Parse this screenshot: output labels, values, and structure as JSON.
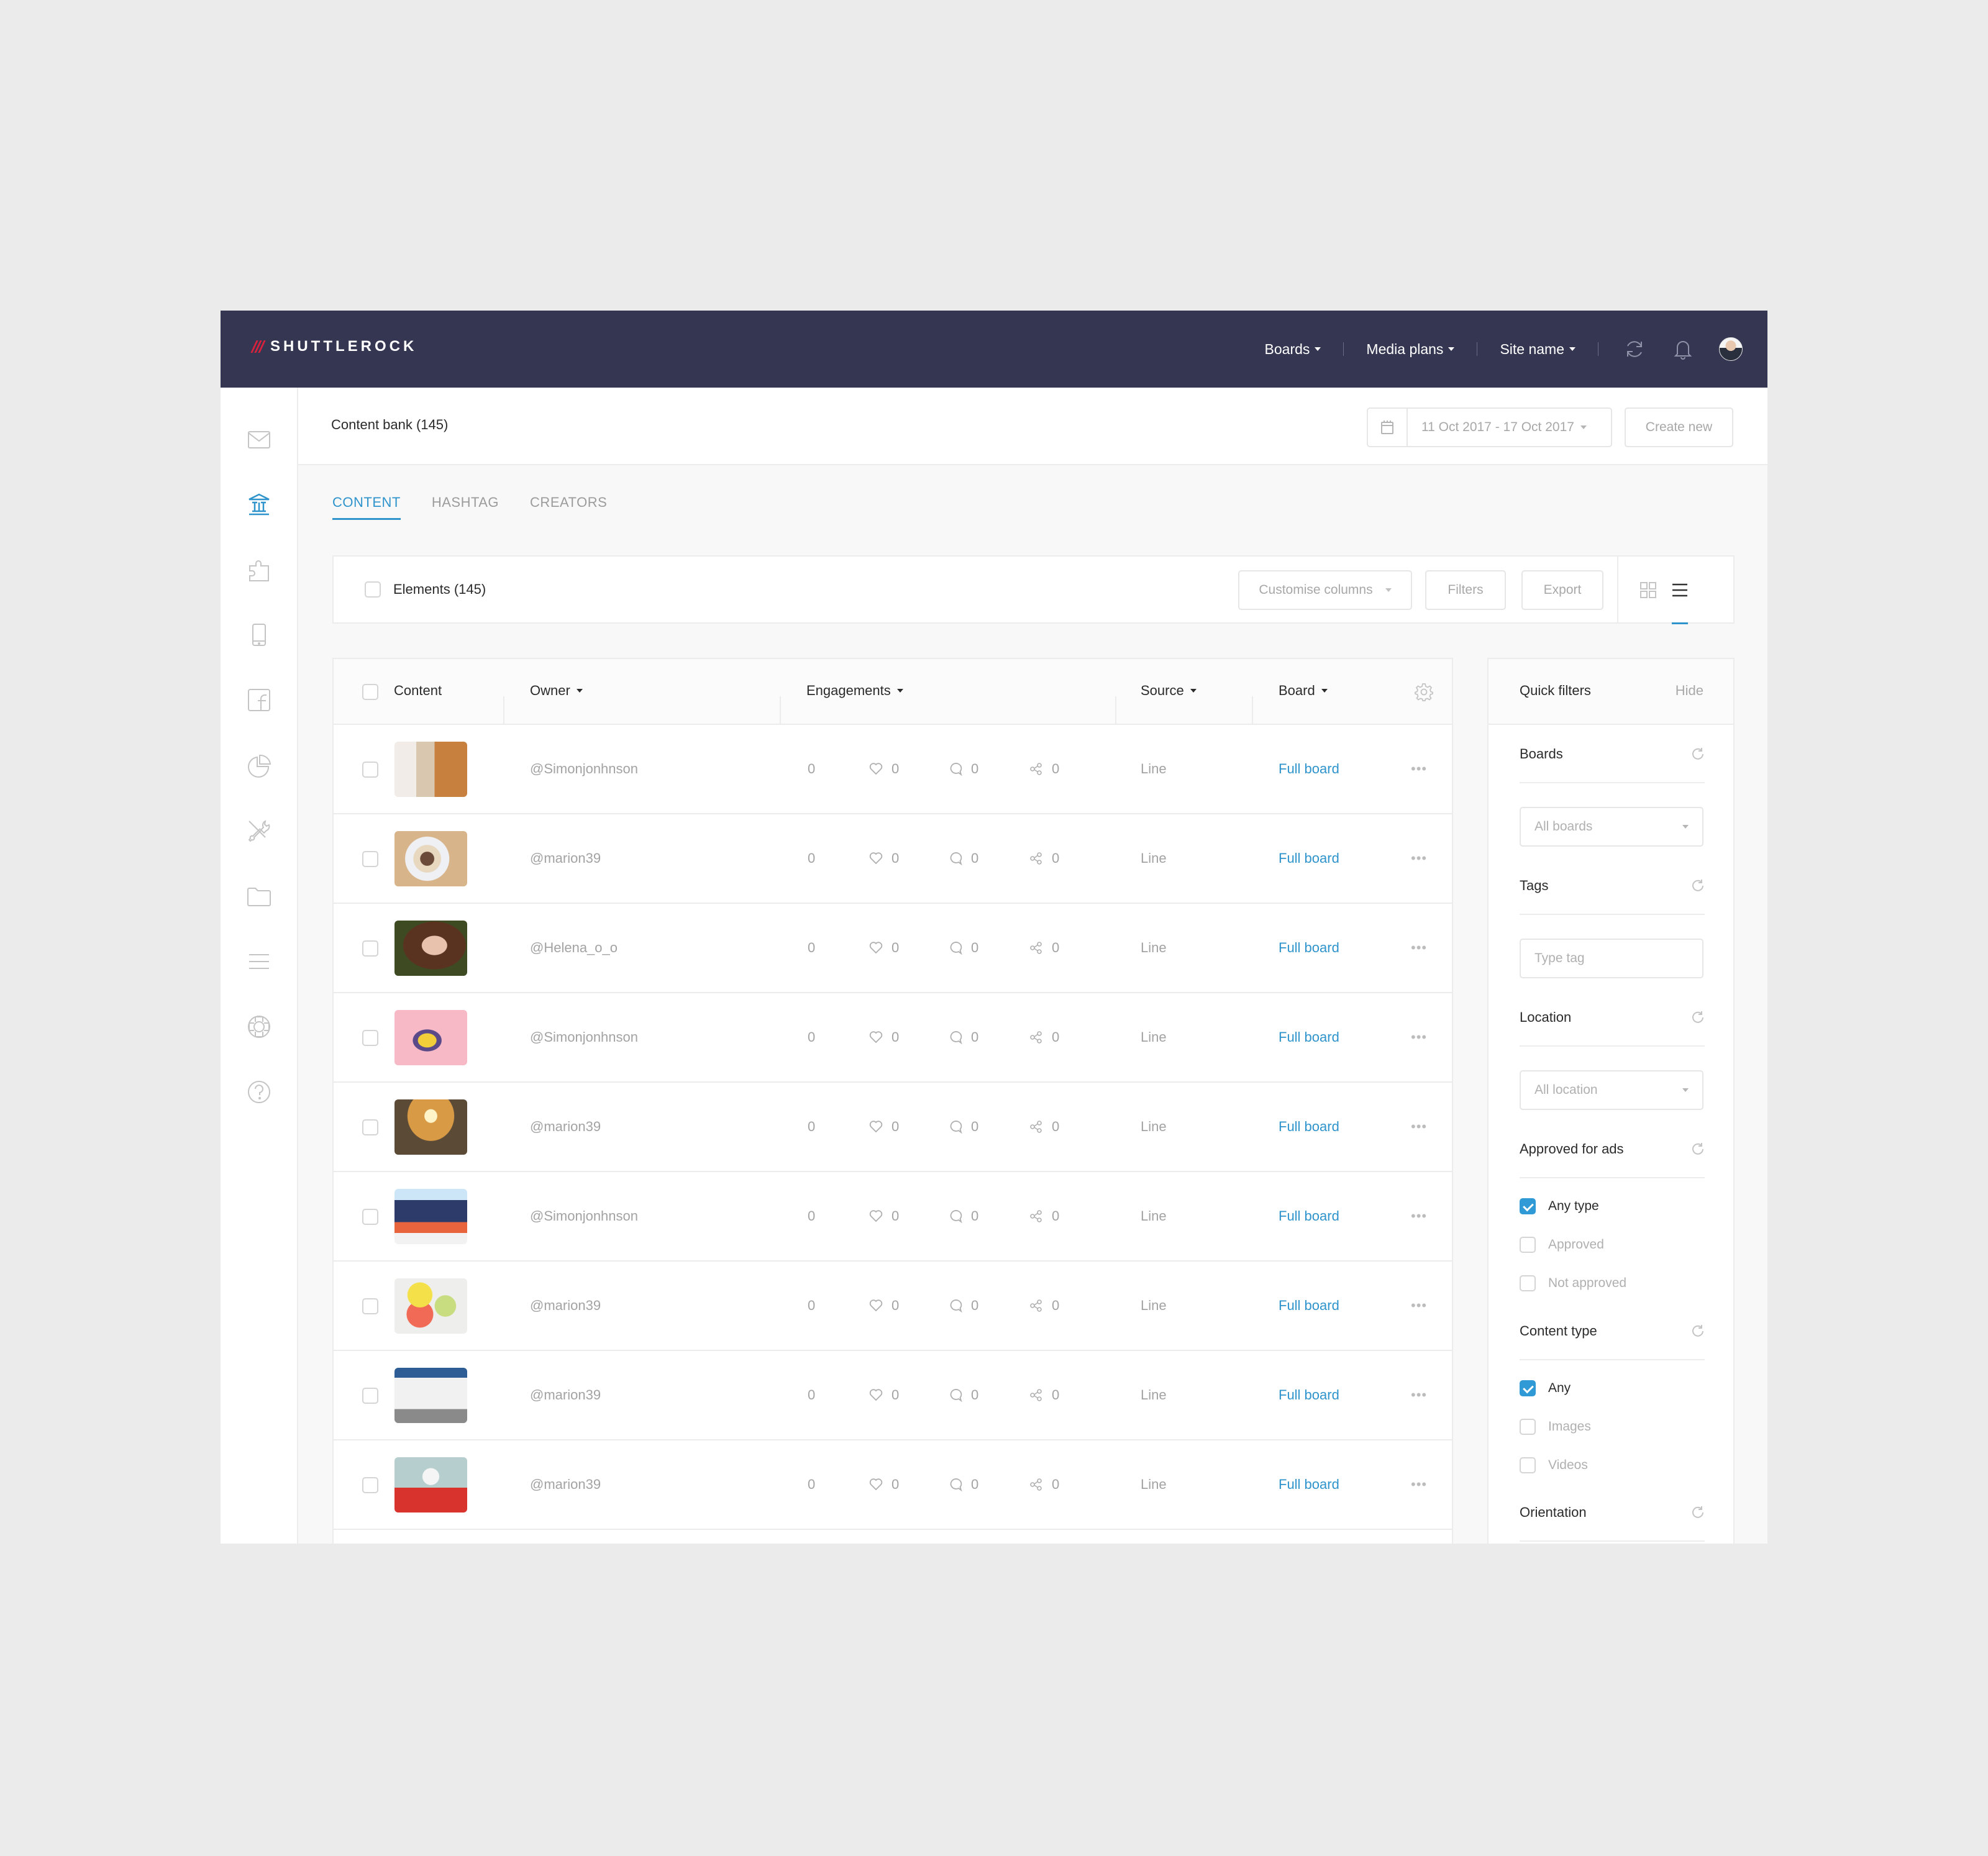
{
  "app": {
    "brand": "SHUTTLEROCK",
    "colors": {
      "header_bg": "#353752",
      "accent": "#2f93cc",
      "logo_red": "#d8213c",
      "checkbox": "#2f9ad6"
    }
  },
  "nav": {
    "items": [
      {
        "label": "Boards",
        "icon": "caret-down-icon"
      },
      {
        "label": "Media plans",
        "icon": "caret-down-icon"
      },
      {
        "label": "Site name",
        "icon": "caret-down-icon"
      }
    ],
    "icons": [
      "refresh-icon",
      "bell-icon",
      "user-avatar"
    ]
  },
  "sidebar": {
    "items": [
      {
        "icon": "mail-icon",
        "active": false
      },
      {
        "icon": "bank-icon",
        "active": true
      },
      {
        "icon": "puzzle-icon",
        "active": false
      },
      {
        "icon": "mobile-icon",
        "active": false
      },
      {
        "icon": "facebook-icon",
        "active": false
      },
      {
        "icon": "pie-chart-icon",
        "active": false
      },
      {
        "icon": "tools-icon",
        "active": false
      },
      {
        "icon": "folder-icon",
        "active": false
      },
      {
        "icon": "list-icon",
        "active": false
      },
      {
        "icon": "lifebuoy-icon",
        "active": false
      },
      {
        "icon": "help-icon",
        "active": false
      }
    ]
  },
  "page": {
    "title": "Content bank (145)",
    "date_range": "11 Oct 2017 - 17 Oct 2017",
    "create_label": "Create new"
  },
  "tabs": [
    {
      "label": "CONTENT",
      "active": true
    },
    {
      "label": "HASHTAG",
      "active": false
    },
    {
      "label": "CREATORS",
      "active": false
    }
  ],
  "toolbar": {
    "elements_label": "Elements (145)",
    "customise_label": "Customise columns",
    "filters_label": "Filters",
    "export_label": "Export",
    "view_modes": [
      {
        "icon": "grid-view-icon",
        "active": false
      },
      {
        "icon": "list-view-icon",
        "active": true
      }
    ]
  },
  "table": {
    "columns": [
      {
        "label": "Content",
        "sortable": false
      },
      {
        "label": "Owner",
        "sortable": true
      },
      {
        "label": "Engagements",
        "sortable": true
      },
      {
        "label": "Source",
        "sortable": true
      },
      {
        "label": "Board",
        "sortable": true
      }
    ],
    "settings_icon": "gear-icon",
    "rows": [
      {
        "thumb": "woman-laptop-bag",
        "owner": "@Simonjonhnson",
        "total": "0",
        "likes": "0",
        "comments": "0",
        "shares": "0",
        "source": "Line",
        "board": "Full board"
      },
      {
        "thumb": "breakfast-bowl",
        "owner": "@marion39",
        "total": "0",
        "likes": "0",
        "comments": "0",
        "shares": "0",
        "source": "Line",
        "board": "Full board"
      },
      {
        "thumb": "woman-lying-grass",
        "owner": "@Helena_o_o",
        "total": "0",
        "likes": "0",
        "comments": "0",
        "shares": "0",
        "source": "Line",
        "board": "Full board"
      },
      {
        "thumb": "banana-pink",
        "owner": "@Simonjonhnson",
        "total": "0",
        "likes": "0",
        "comments": "0",
        "shares": "0",
        "source": "Line",
        "board": "Full board"
      },
      {
        "thumb": "woman-sunset",
        "owner": "@marion39",
        "total": "0",
        "likes": "0",
        "comments": "0",
        "shares": "0",
        "source": "Line",
        "board": "Full board"
      },
      {
        "thumb": "building-corner",
        "owner": "@Simonjonhnson",
        "total": "0",
        "likes": "0",
        "comments": "0",
        "shares": "0",
        "source": "Line",
        "board": "Full board"
      },
      {
        "thumb": "macarons",
        "owner": "@marion39",
        "total": "0",
        "likes": "0",
        "comments": "0",
        "shares": "0",
        "source": "Line",
        "board": "Full board"
      },
      {
        "thumb": "white-architecture",
        "owner": "@marion39",
        "total": "0",
        "likes": "0",
        "comments": "0",
        "shares": "0",
        "source": "Line",
        "board": "Full board"
      },
      {
        "thumb": "ferret-red-coat",
        "owner": "@marion39",
        "total": "0",
        "likes": "0",
        "comments": "0",
        "shares": "0",
        "source": "Line",
        "board": "Full board"
      }
    ]
  },
  "quick_filters": {
    "title": "Quick filters",
    "hide_label": "Hide",
    "boards": {
      "label": "Boards",
      "value": "All boards"
    },
    "tags": {
      "label": "Tags",
      "placeholder": "Type tag"
    },
    "location": {
      "label": "Location",
      "value": "All location"
    },
    "approved": {
      "label": "Approved for ads",
      "options": [
        {
          "label": "Any type",
          "checked": true
        },
        {
          "label": "Approved",
          "checked": false
        },
        {
          "label": "Not approved",
          "checked": false
        }
      ]
    },
    "content_type": {
      "label": "Content type",
      "options": [
        {
          "label": "Any",
          "checked": true
        },
        {
          "label": "Images",
          "checked": false
        },
        {
          "label": "Videos",
          "checked": false
        }
      ]
    },
    "orientation": {
      "label": "Orientation"
    }
  }
}
